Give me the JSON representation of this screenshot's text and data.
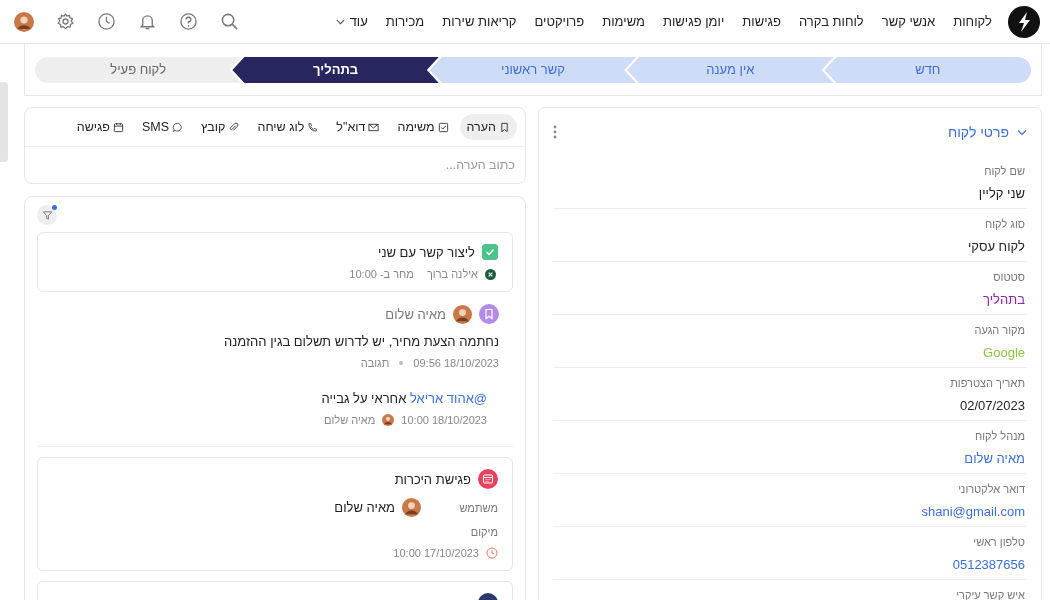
{
  "nav": {
    "items": [
      "לקוחות",
      "אנשי קשר",
      "לוחות בקרה",
      "פגישות",
      "יומן פגישות",
      "משימות",
      "פרויקטים",
      "קריאות שירות",
      "מכירות"
    ],
    "more": "עוד"
  },
  "pipeline": [
    {
      "label": "חדש",
      "selected": false
    },
    {
      "label": "אין מענה",
      "selected": false
    },
    {
      "label": "קשר ראשוני",
      "selected": false
    },
    {
      "label": "בתהליך",
      "selected": true
    },
    {
      "label": "לקוח פעיל",
      "selected": false
    }
  ],
  "composer": {
    "tabs": [
      {
        "label": "הערה",
        "kind": "note",
        "selected": true
      },
      {
        "label": "משימה",
        "kind": "task",
        "selected": false
      },
      {
        "label": "דוא\"ל",
        "kind": "email",
        "selected": false
      },
      {
        "label": "לוג שיחה",
        "kind": "call",
        "selected": false
      },
      {
        "label": "קובץ",
        "kind": "file",
        "selected": false
      },
      {
        "label": "SMS",
        "kind": "sms",
        "selected": false
      },
      {
        "label": "פגישה",
        "kind": "meeting",
        "selected": false
      }
    ],
    "placeholder": "כתוב הערה..."
  },
  "feed": [
    {
      "kind": "task",
      "title": "ליצור קשר עם שני",
      "checked": true,
      "assignee": "אילנה ברוך",
      "due": "מחר ב- 10:00"
    },
    {
      "kind": "note",
      "author": "מאיה שלום",
      "text": "נחתמה הצעת מחיר, יש לדרוש תשלום בגין ההזמנה",
      "time": "18/10/2023 09:56",
      "reply_label": "תגובה",
      "reply": {
        "mention": "@אהוד אריאל",
        "text": "אחראי על גבייה",
        "time": "18/10/2023 10:00",
        "author": "מאיה שלום"
      }
    },
    {
      "kind": "meeting",
      "title": "פגישת היכרות",
      "user_label": "משתמש",
      "user": "מאיה שלום",
      "location_label": "מיקום",
      "time": "17/10/2023 10:00"
    },
    {
      "kind": "event"
    }
  ],
  "details": {
    "title": "פרטי לקוח",
    "expanded": true,
    "fields": [
      {
        "label": "שם לקוח",
        "value": "שני קליין",
        "kind": "text"
      },
      {
        "label": "סוג לקוח",
        "value": "לקוח עסקי",
        "kind": "text"
      },
      {
        "label": "סטטוס",
        "value": "בתהליך",
        "kind": "status",
        "color": "#8e24aa"
      },
      {
        "label": "מקור הגעה",
        "value": "Google",
        "kind": "status",
        "color": "#8bc34a"
      },
      {
        "label": "תאריך הצטרפות",
        "value": "02/07/2023",
        "kind": "text"
      },
      {
        "label": "מנהל לקוח",
        "value": "מאיה שלום",
        "kind": "link"
      },
      {
        "label": "דואר אלקטרוני",
        "value": "shani@gmail.com",
        "kind": "link"
      },
      {
        "label": "טלפון ראשי",
        "value": "0512387656",
        "kind": "link"
      },
      {
        "label": "איש קשר עיקרי"
      }
    ]
  }
}
